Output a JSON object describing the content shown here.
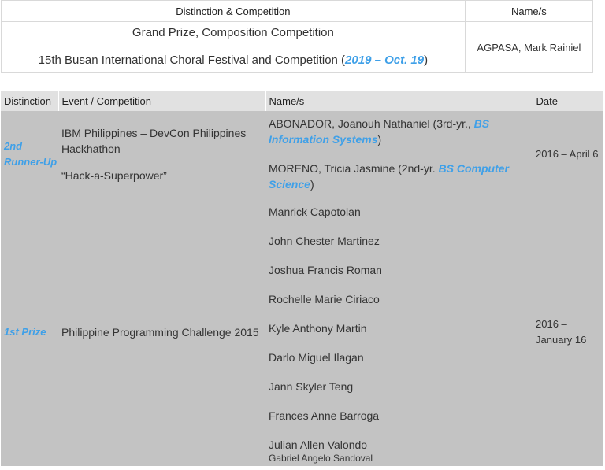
{
  "table1": {
    "headers": [
      "Distinction & Competition",
      "Name/s"
    ],
    "row": {
      "prize": "Grand Prize, Composition Competition",
      "festival_prefix": "15th Busan International Choral Festival and Competition (",
      "festival_link": "2019 – Oct. 19",
      "festival_suffix": ")",
      "name": "AGPASA, Mark Rainiel"
    }
  },
  "table2": {
    "headers": [
      "Distinction",
      "Event / Competition",
      "Name/s",
      "Date"
    ],
    "rows": [
      {
        "distinction": "2nd Runner-Up",
        "event_line1": "IBM Philippines – DevCon Philippines Hackhathon",
        "event_line2": "“Hack-a-Superpower”",
        "names": [
          {
            "prefix": "ABONADOR, Joanouh Nathaniel (3rd-yr., ",
            "link": "BS Information Systems",
            "suffix": ")"
          },
          {
            "prefix": "MORENO, Tricia Jasmine (2nd-yr. ",
            "link": "BS Computer Science",
            "suffix": ")"
          }
        ],
        "date": "2016 – April 6"
      },
      {
        "distinction": "1st Prize",
        "event": "Philippine Programming Challenge 2015",
        "names": [
          "Manrick Capotolan",
          "John Chester Martinez",
          "Joshua Francis Roman",
          "Rochelle Marie Ciriaco",
          "Kyle Anthony Martin",
          "Darlo Miguel Ilagan",
          "Jann Skyler Teng",
          "Frances Anne Barroga",
          "Julian Allen Valondo",
          "Gabriel Angelo Sandoval"
        ],
        "date": "2016 – January 16"
      }
    ]
  }
}
